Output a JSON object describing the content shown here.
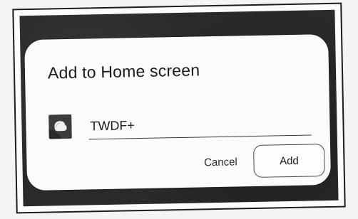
{
  "dialog": {
    "title": "Add to Home screen",
    "app_icon": "app-shortcut-icon",
    "name_value": "TWDF+",
    "cancel_label": "Cancel",
    "add_label": "Add"
  },
  "colors": {
    "dialog_background": "#fbfbfb",
    "screen_background": "#2a2a2a",
    "text": "#1a1a1a",
    "underline": "#3a3a3a"
  }
}
